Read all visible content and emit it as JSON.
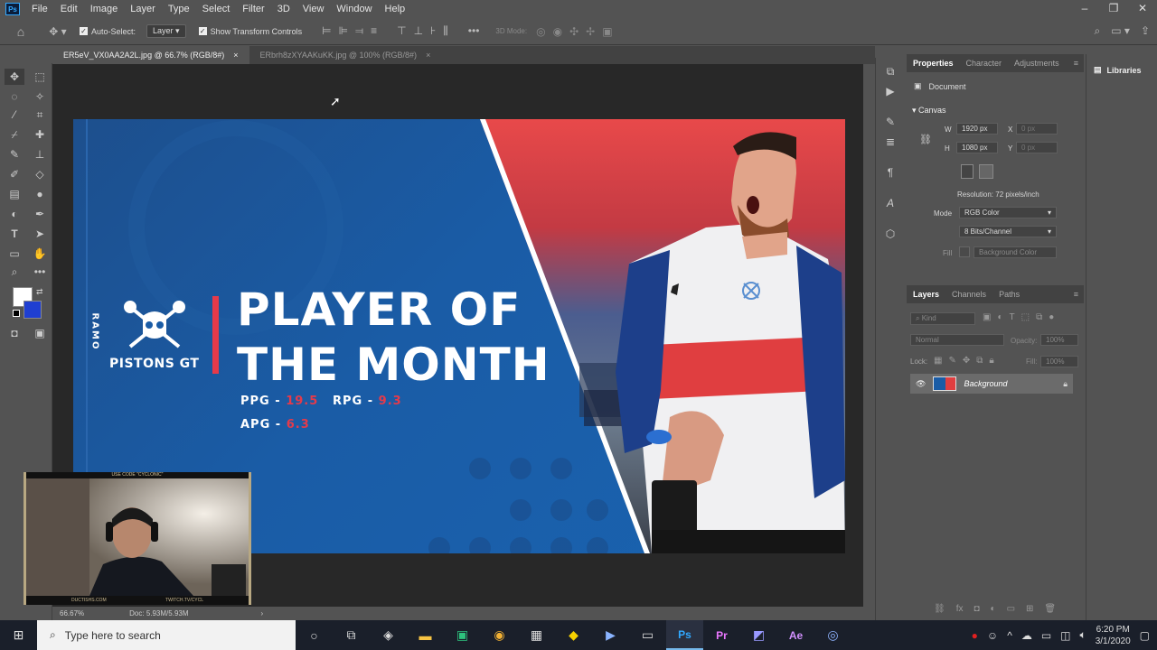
{
  "menu": {
    "app_icon": "Ps",
    "items": [
      "File",
      "Edit",
      "Image",
      "Layer",
      "Type",
      "Select",
      "Filter",
      "3D",
      "View",
      "Window",
      "Help"
    ]
  },
  "options": {
    "auto_select_label": "Auto-Select:",
    "auto_select_value": "Layer",
    "show_transform_label": "Show Transform Controls",
    "mode_3d_label": "3D Mode:"
  },
  "tabs": [
    {
      "label": "ER5eV_VX0AA2A2L.jpg @ 66.7% (RGB/8#)",
      "close": "×"
    },
    {
      "label": "ERbrh8zXYAAKuKK.jpg @ 100% (RGB/8#)",
      "close": "×"
    }
  ],
  "poster": {
    "side_text": "RAMO",
    "team_name": "PISTONS GT",
    "title_line1": "PLAYER OF",
    "title_line2": "THE MONTH",
    "stats": [
      {
        "label": "PPG - ",
        "value": "19.5"
      },
      {
        "label": "RPG - ",
        "value": "9.3"
      },
      {
        "label": "APG - ",
        "value": "6.3"
      }
    ]
  },
  "webcam": {
    "top_text": "USE CODE \"CYCLONIC\"",
    "bottom_left": "DUCTISHS.COM",
    "bottom_right": "TWITCH.TV/CYCL"
  },
  "status": {
    "zoom": "66.67%",
    "doc": "Doc: 5.93M/5.93M"
  },
  "properties": {
    "tabs": [
      "Properties",
      "Character",
      "Adjustments"
    ],
    "section_document": "Document",
    "section_canvas": "Canvas",
    "w_label": "W",
    "w_value": "1920 px",
    "h_label": "H",
    "h_value": "1080 px",
    "x_label": "X",
    "x_placeholder": "0 px",
    "y_label": "Y",
    "y_placeholder": "0 px",
    "resolution": "Resolution: 72 pixels/inch",
    "mode_label": "Mode",
    "mode_value": "RGB Color",
    "bits_value": "8 Bits/Channel",
    "fill_label": "Fill",
    "fill_value": "Background Color"
  },
  "layers": {
    "tabs": [
      "Layers",
      "Channels",
      "Paths"
    ],
    "kind_placeholder": "Kind",
    "blend_mode": "Normal",
    "opacity_label": "Opacity:",
    "opacity_value": "100%",
    "lock_label": "Lock:",
    "fill_label": "Fill:",
    "fill_value": "100%",
    "layer_name": "Background"
  },
  "libraries": {
    "label": "Libraries"
  },
  "taskbar": {
    "search_placeholder": "Type here to search",
    "time": "6:20 PM",
    "date": "3/1/2020"
  },
  "colors": {
    "accent_red": "#e63a4a",
    "poster_blue": "#1a5ca6",
    "ps_blue": "#31a8ff",
    "foreground": "#ffffff",
    "background": "#1f3fd1"
  }
}
